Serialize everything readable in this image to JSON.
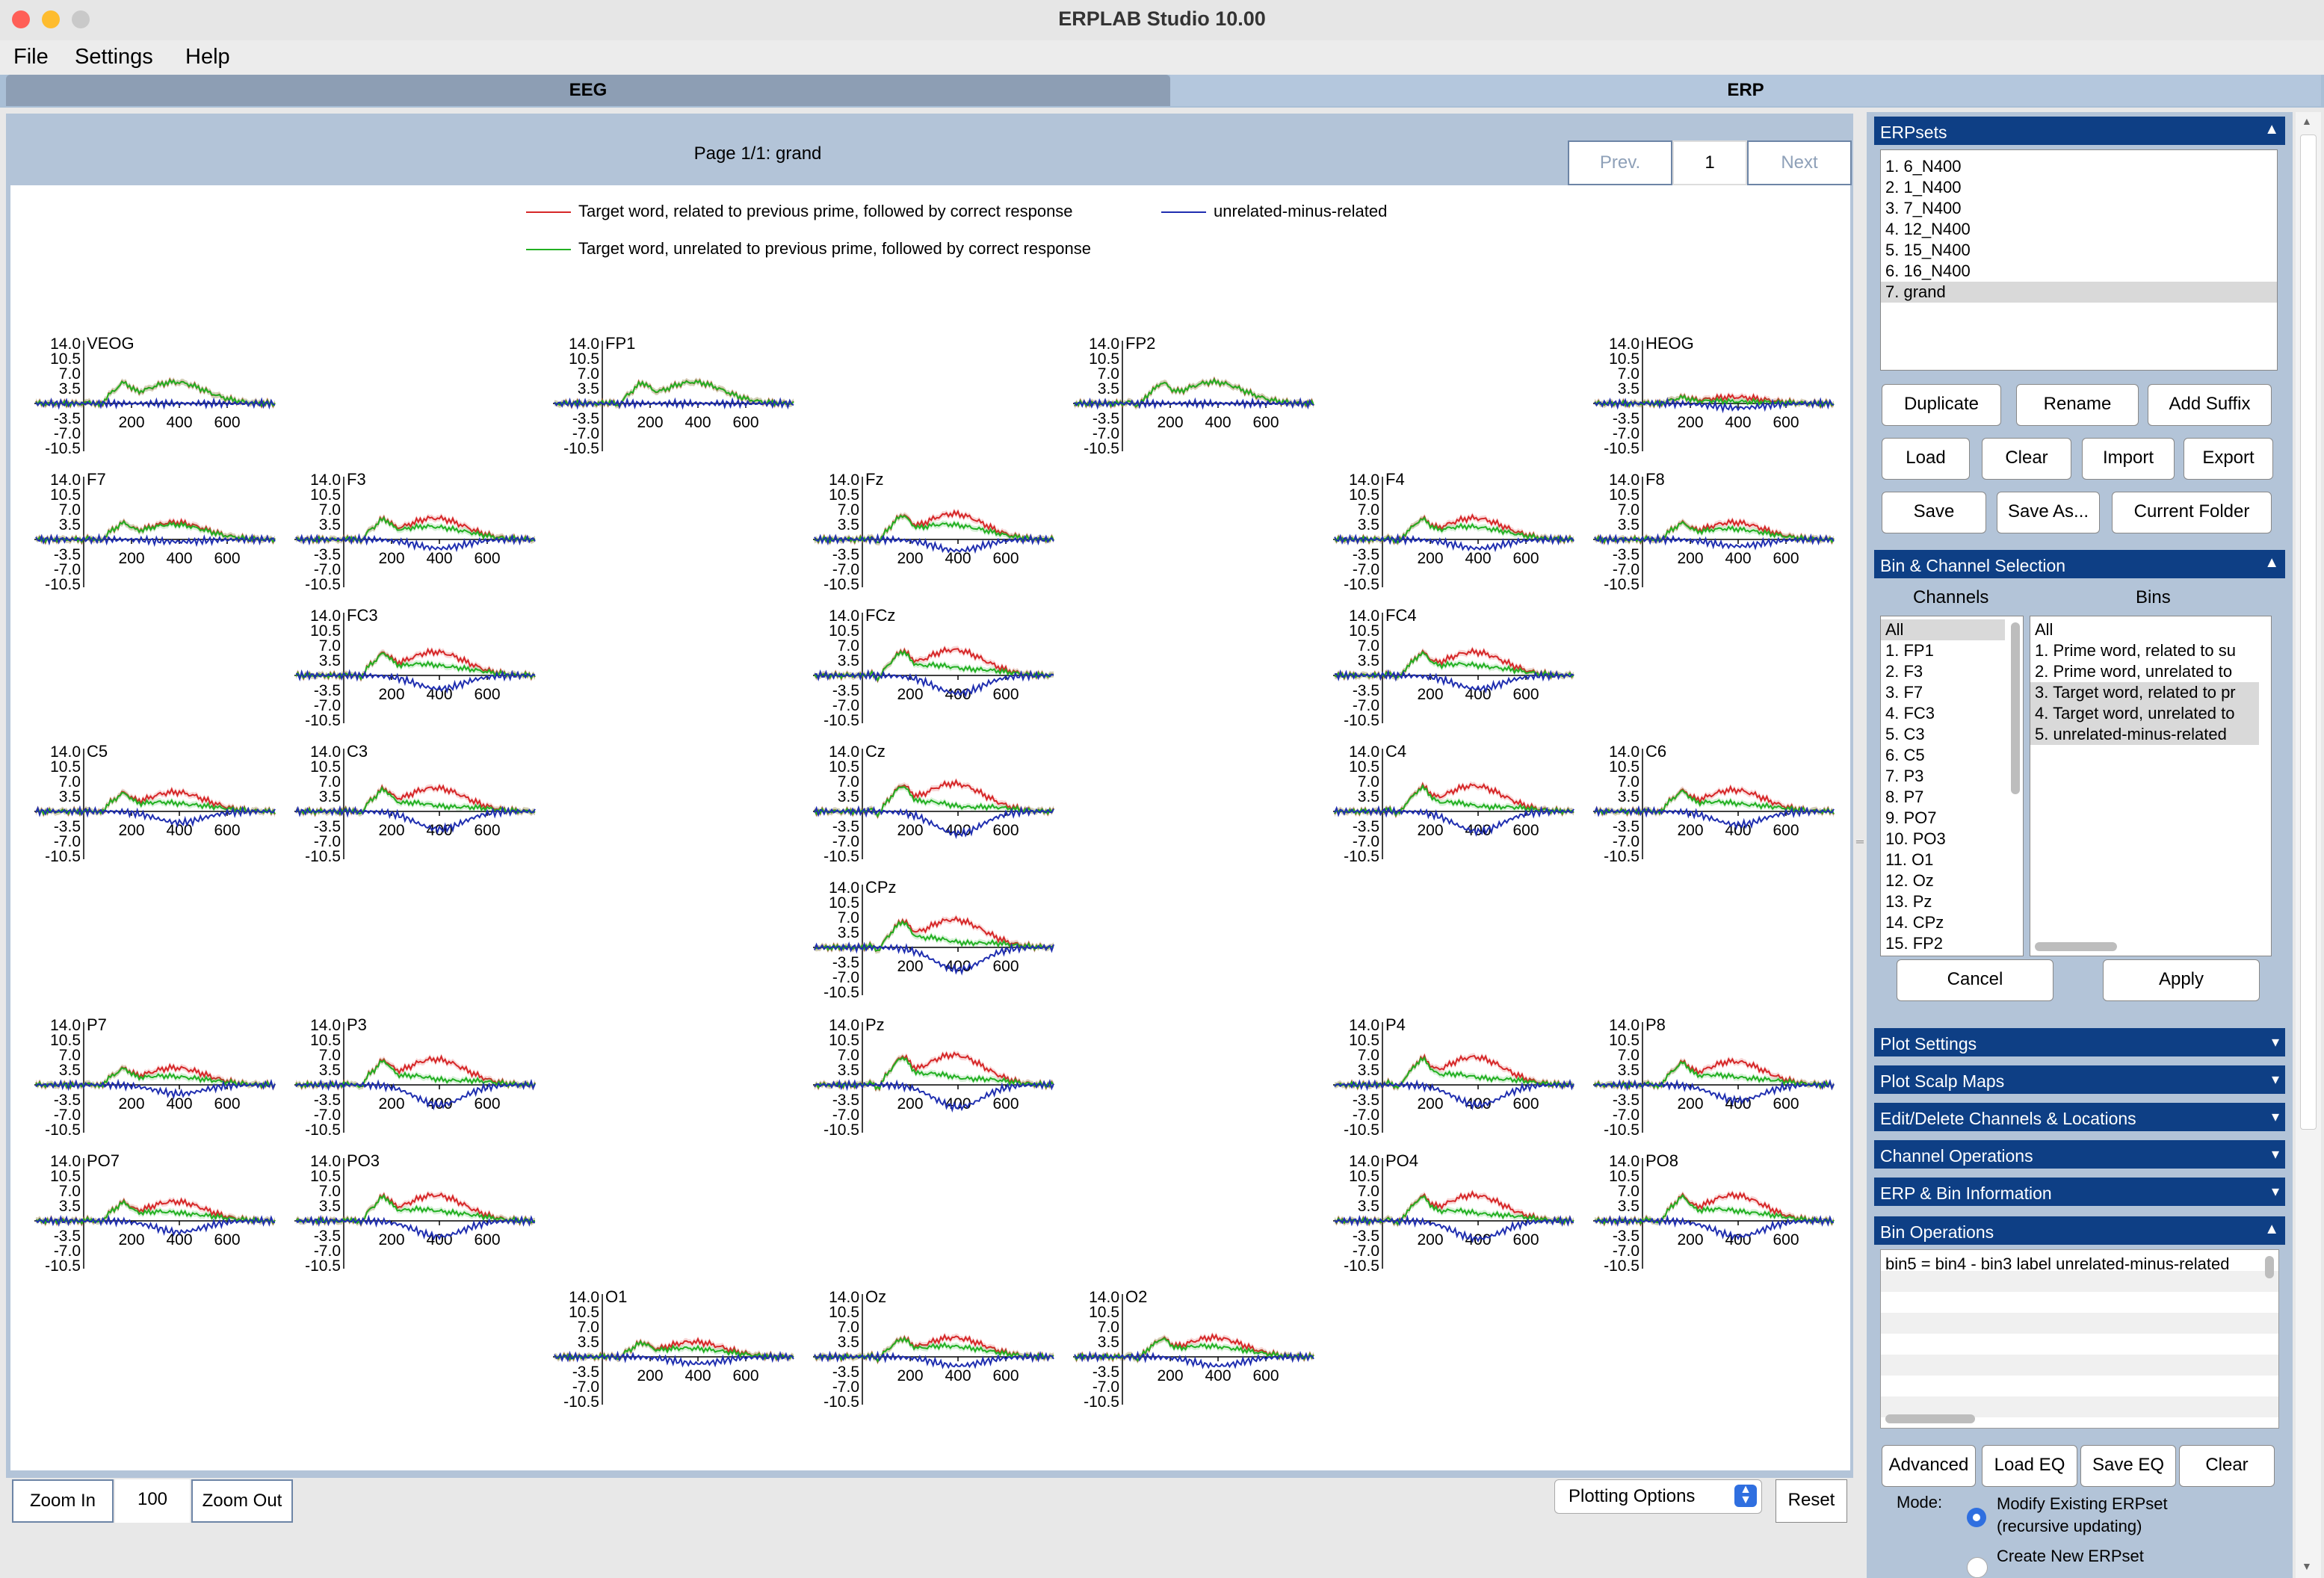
{
  "window": {
    "title": "ERPLAB Studio 10.00",
    "traffic": [
      "#ff5f57",
      "#febc2e",
      "#c9c9c9"
    ]
  },
  "menu": [
    "File",
    "Settings",
    "Help"
  ],
  "tabs": {
    "eeg": "EEG",
    "erp": "ERP"
  },
  "viewer": {
    "page_label": "Page 1/1: grand",
    "prev": "Prev.",
    "page": "1",
    "next": "Next",
    "zoom_in": "Zoom In",
    "zoom_value": "100",
    "zoom_out": "Zoom Out",
    "plotting_options": "Plotting Options",
    "reset": "Reset"
  },
  "legend": [
    {
      "name": "Target word, related to previous prime, followed by correct response",
      "color": "#d62728"
    },
    {
      "name": "unrelated-minus-related",
      "color": "#1f2eb0"
    },
    {
      "name": "Target word, unrelated to previous prime, followed by correct response",
      "color": "#22b022"
    }
  ],
  "chart_data": {
    "type": "line",
    "y_ticks": [
      "14.0",
      "10.5",
      "7.0",
      "3.5",
      "-3.5",
      "-7.0",
      "-10.5"
    ],
    "x_ticks": [
      "200",
      "400",
      "600"
    ],
    "ylim": [
      -10.5,
      14.0
    ],
    "xlim": [
      -200,
      800
    ],
    "series": [
      {
        "name": "Target word, related to previous prime, followed by correct response",
        "color": "#d62728"
      },
      {
        "name": "Target word, unrelated to previous prime, followed by correct response",
        "color": "#22b022"
      },
      {
        "name": "unrelated-minus-related",
        "color": "#1f2eb0"
      }
    ],
    "channels": [
      {
        "label": "VEOG",
        "r": 0,
        "c": 0,
        "amp": 1.0,
        "n4": 0.0
      },
      {
        "label": "FP1",
        "r": 0,
        "c": 2,
        "amp": 1.0,
        "n4": 0.0
      },
      {
        "label": "FP2",
        "r": 0,
        "c": 4,
        "amp": 1.0,
        "n4": 0.0
      },
      {
        "label": "HEOG",
        "r": 0,
        "c": 6,
        "amp": 0.3,
        "n4": 0.2
      },
      {
        "label": "F7",
        "r": 1,
        "c": 0,
        "amp": 0.8,
        "n4": 0.1
      },
      {
        "label": "F3",
        "r": 1,
        "c": 1,
        "amp": 1.0,
        "n4": 0.4
      },
      {
        "label": "Fz",
        "r": 1,
        "c": 3,
        "amp": 1.2,
        "n4": 0.5
      },
      {
        "label": "F4",
        "r": 1,
        "c": 5,
        "amp": 1.0,
        "n4": 0.4
      },
      {
        "label": "F8",
        "r": 1,
        "c": 6,
        "amp": 0.8,
        "n4": 0.3
      },
      {
        "label": "FC3",
        "r": 2,
        "c": 1,
        "amp": 1.1,
        "n4": 0.6
      },
      {
        "label": "FCz",
        "r": 2,
        "c": 3,
        "amp": 1.2,
        "n4": 0.8
      },
      {
        "label": "FC4",
        "r": 2,
        "c": 5,
        "amp": 1.1,
        "n4": 0.6
      },
      {
        "label": "C5",
        "r": 3,
        "c": 0,
        "amp": 0.9,
        "n4": 0.5
      },
      {
        "label": "C3",
        "r": 3,
        "c": 1,
        "amp": 1.1,
        "n4": 0.8
      },
      {
        "label": "Cz",
        "r": 3,
        "c": 3,
        "amp": 1.3,
        "n4": 1.0
      },
      {
        "label": "C4",
        "r": 3,
        "c": 5,
        "amp": 1.2,
        "n4": 0.9
      },
      {
        "label": "C6",
        "r": 3,
        "c": 6,
        "amp": 1.0,
        "n4": 0.6
      },
      {
        "label": "CPz",
        "r": 4,
        "c": 3,
        "amp": 1.3,
        "n4": 1.0
      },
      {
        "label": "P7",
        "r": 5,
        "c": 0,
        "amp": 0.8,
        "n4": 0.4
      },
      {
        "label": "P3",
        "r": 5,
        "c": 1,
        "amp": 1.2,
        "n4": 0.9
      },
      {
        "label": "Pz",
        "r": 5,
        "c": 3,
        "amp": 1.4,
        "n4": 1.0
      },
      {
        "label": "P4",
        "r": 5,
        "c": 5,
        "amp": 1.3,
        "n4": 0.9
      },
      {
        "label": "P8",
        "r": 5,
        "c": 6,
        "amp": 1.1,
        "n4": 0.7
      },
      {
        "label": "PO7",
        "r": 6,
        "c": 0,
        "amp": 0.9,
        "n4": 0.5
      },
      {
        "label": "PO3",
        "r": 6,
        "c": 1,
        "amp": 1.2,
        "n4": 0.7
      },
      {
        "label": "PO4",
        "r": 6,
        "c": 5,
        "amp": 1.2,
        "n4": 0.8
      },
      {
        "label": "PO8",
        "r": 6,
        "c": 6,
        "amp": 1.2,
        "n4": 0.7
      },
      {
        "label": "O1",
        "r": 7,
        "c": 2,
        "amp": 0.7,
        "n4": 0.3
      },
      {
        "label": "Oz",
        "r": 7,
        "c": 3,
        "amp": 0.9,
        "n4": 0.4
      },
      {
        "label": "O2",
        "r": 7,
        "c": 4,
        "amp": 0.9,
        "n4": 0.4
      }
    ]
  },
  "erpsets": {
    "title": "ERPsets",
    "items": [
      "1. 6_N400",
      "2. 1_N400",
      "3. 7_N400",
      "4. 12_N400",
      "5. 15_N400",
      "6. 16_N400",
      "7. grand"
    ],
    "buttons": [
      "Duplicate",
      "Rename",
      "Add Suffix",
      "Load",
      "Clear",
      "Import",
      "Export",
      "Save",
      "Save As...",
      "Current Folder"
    ]
  },
  "binchan": {
    "title": "Bin & Channel Selection",
    "channels_label": "Channels",
    "bins_label": "Bins",
    "channels": [
      "All",
      "1. FP1",
      "2. F3",
      "3. F7",
      "4. FC3",
      "5. C3",
      "6. C5",
      "7. P3",
      "8. P7",
      "9. PO7",
      "10. PO3",
      "11. O1",
      "12. Oz",
      "13. Pz",
      "14. CPz",
      "15. FP2"
    ],
    "bins": [
      "All",
      "1. Prime word, related to su",
      "2. Prime word, unrelated to",
      "3. Target word, related to pr",
      "4. Target word, unrelated to",
      "5. unrelated-minus-related"
    ],
    "cancel": "Cancel",
    "apply": "Apply"
  },
  "collapsed_panels": [
    "Plot Settings",
    "Plot Scalp Maps",
    "Edit/Delete Channels & Locations",
    "Channel Operations",
    "ERP & Bin Information"
  ],
  "binops": {
    "title": "Bin Operations",
    "equation": "bin5 = bin4 - bin3 label unrelated-minus-related",
    "buttons": [
      "Advanced",
      "Load EQ",
      "Save EQ",
      "Clear"
    ],
    "mode_label": "Mode:",
    "modify_label": "Modify Existing ERPset",
    "modify_sub": "(recursive updating)",
    "create_label": "Create New ERPset"
  }
}
